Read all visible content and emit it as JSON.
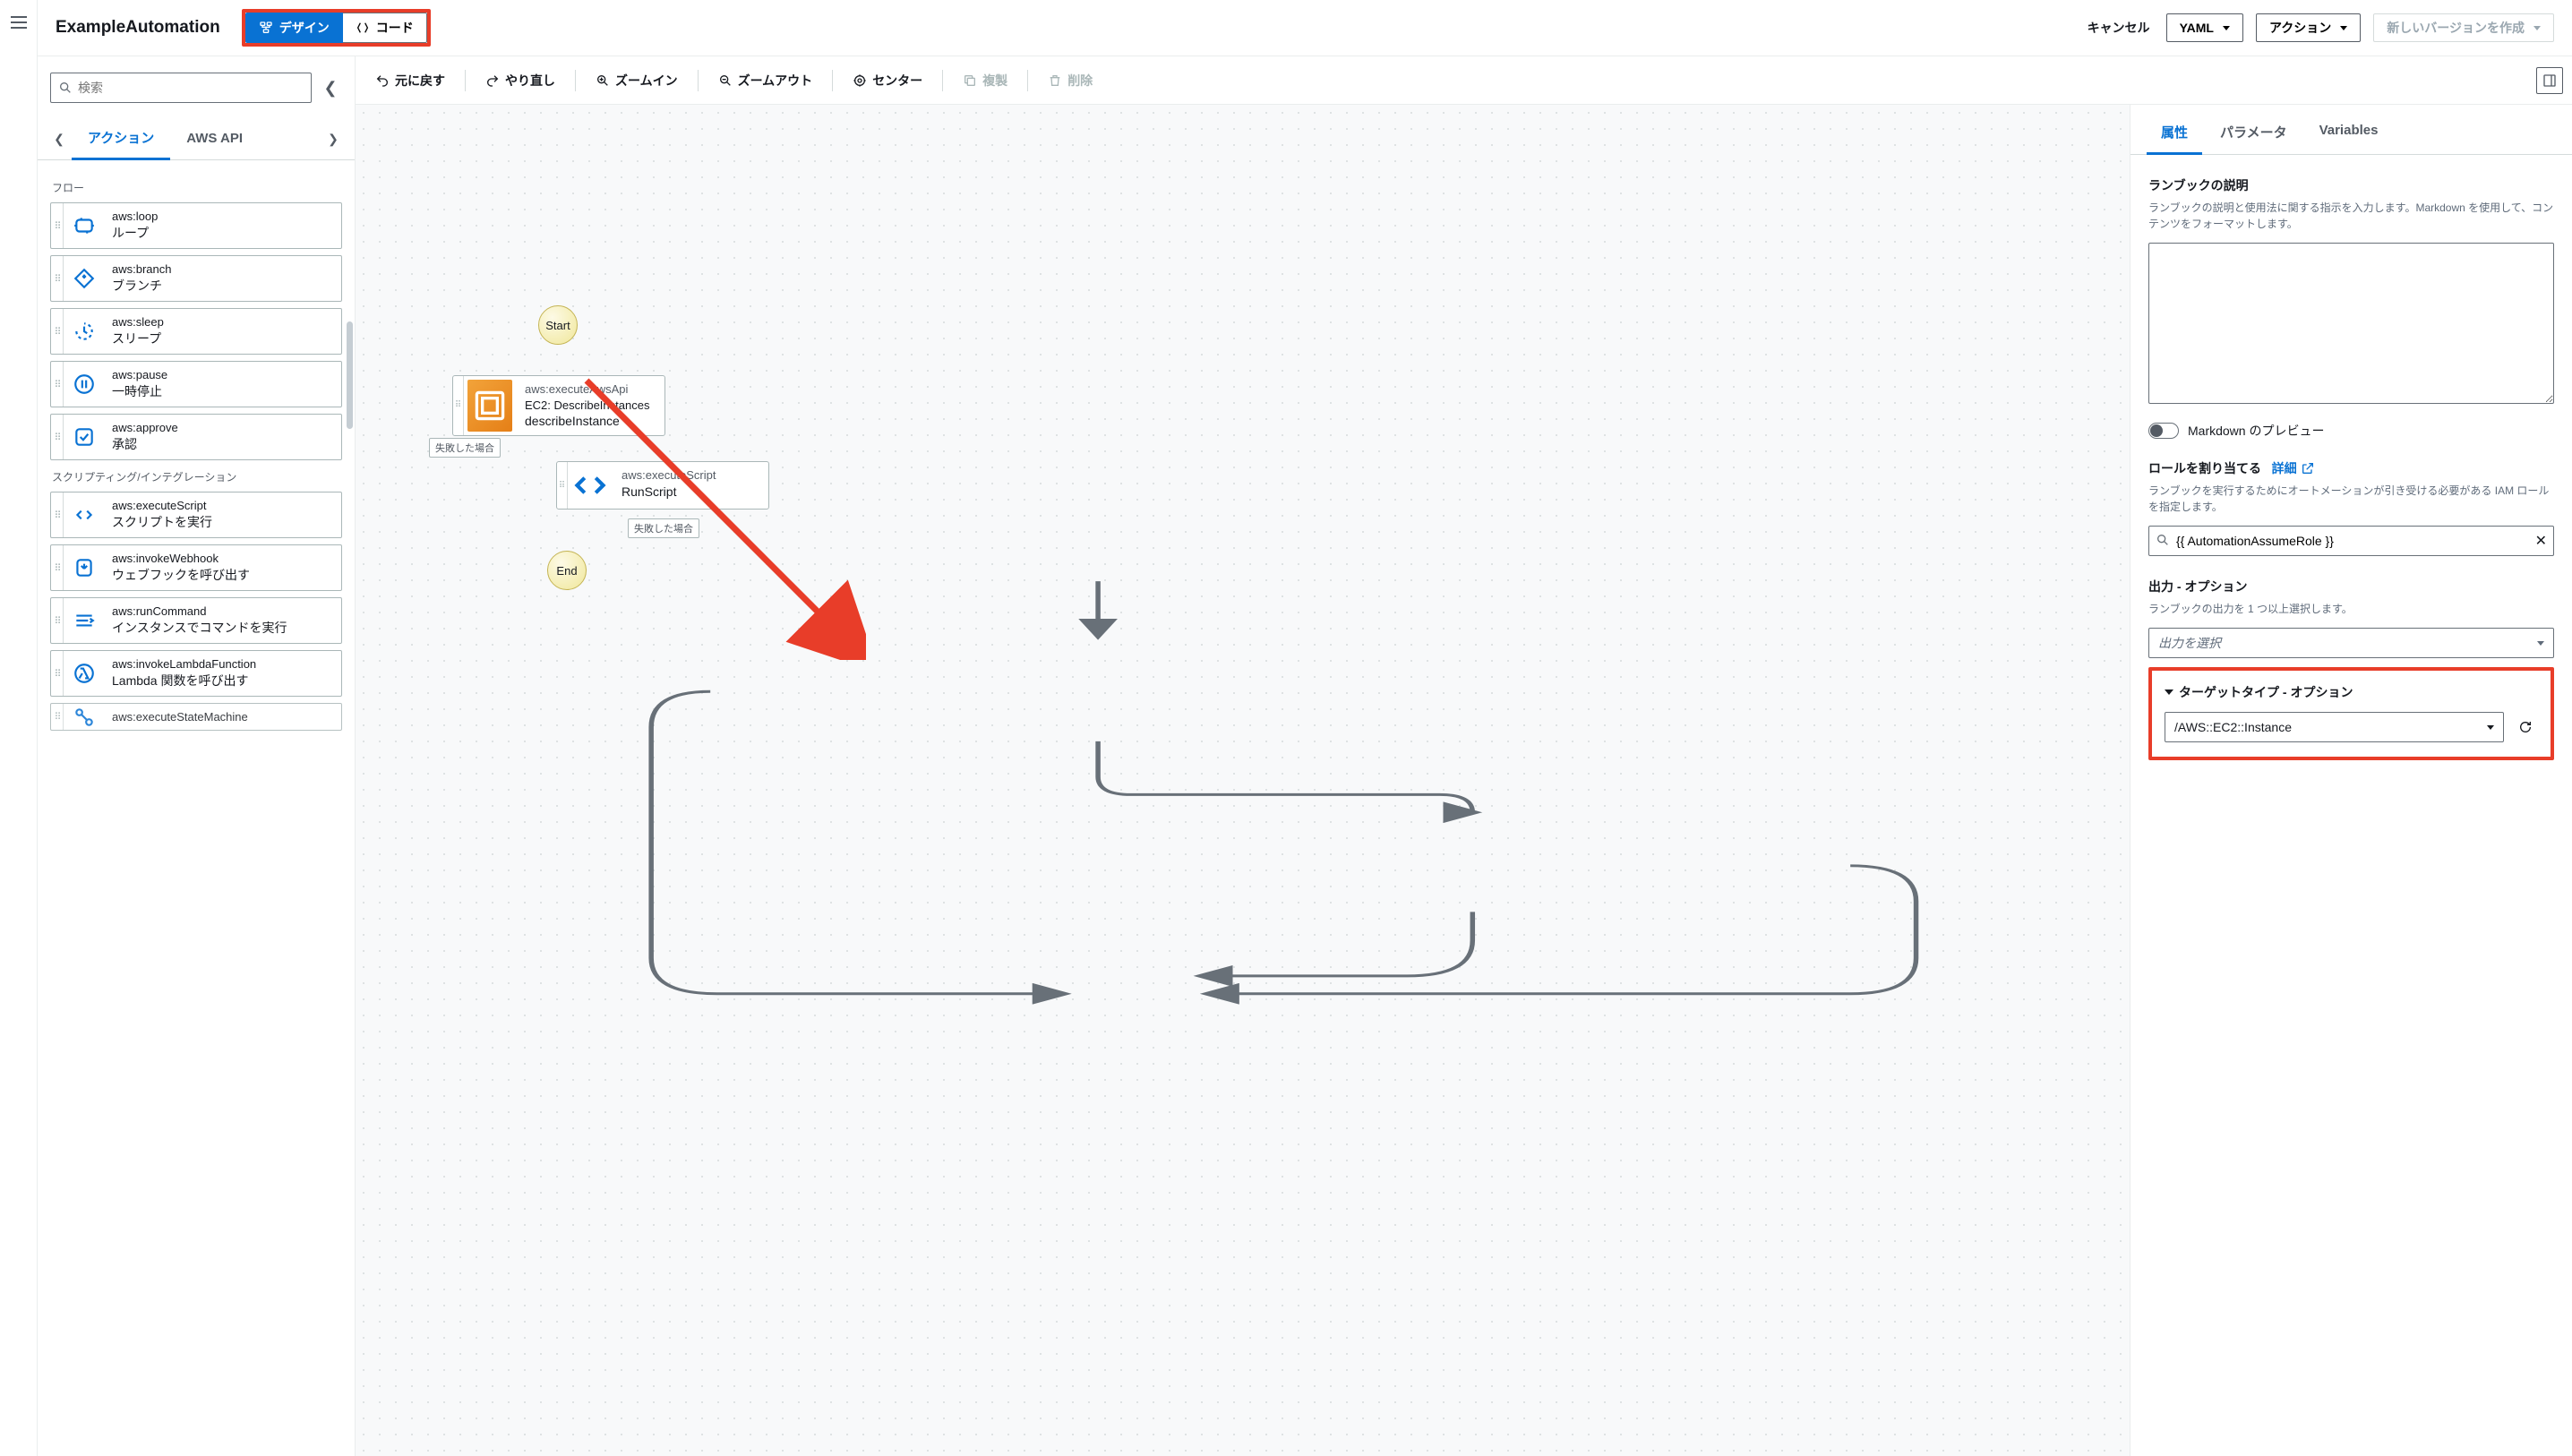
{
  "header": {
    "title": "ExampleAutomation",
    "design_label": "デザイン",
    "code_label": "コード",
    "cancel": "キャンセル",
    "format_select": "YAML",
    "actions_label": "アクション",
    "create_version": "新しいバージョンを作成"
  },
  "left_panel": {
    "search_placeholder": "検索",
    "tabs": {
      "actions": "アクション",
      "aws_api": "AWS API"
    },
    "sections": {
      "flow": "フロー",
      "scripting": "スクリプティング/インテグレーション"
    },
    "actions": {
      "loop": {
        "name": "aws:loop",
        "desc": "ループ"
      },
      "branch": {
        "name": "aws:branch",
        "desc": "ブランチ"
      },
      "sleep": {
        "name": "aws:sleep",
        "desc": "スリープ"
      },
      "pause": {
        "name": "aws:pause",
        "desc": "一時停止"
      },
      "approve": {
        "name": "aws:approve",
        "desc": "承認"
      },
      "executeScript": {
        "name": "aws:executeScript",
        "desc": "スクリプトを実行"
      },
      "invokeWebhook": {
        "name": "aws:invokeWebhook",
        "desc": "ウェブフックを呼び出す"
      },
      "runCommand": {
        "name": "aws:runCommand",
        "desc": "インスタンスでコマンドを実行"
      },
      "invokeLambda": {
        "name": "aws:invokeLambdaFunction",
        "desc": "Lambda 関数を呼び出す"
      },
      "executeStateMachine": {
        "name": "aws:executeStateMachine",
        "desc": ""
      }
    }
  },
  "toolbar": {
    "undo": "元に戻す",
    "redo": "やり直し",
    "zoom_in": "ズームイン",
    "zoom_out": "ズームアウト",
    "center": "センター",
    "duplicate": "複製",
    "delete": "削除"
  },
  "canvas": {
    "start": "Start",
    "end": "End",
    "fail_label": "失敗した場合",
    "step1": {
      "l1": "aws:executeAwsApi",
      "l2": "EC2: DescribeInstances",
      "l3": "describeInstance"
    },
    "step2": {
      "l1": "aws:executeScript",
      "l3": "RunScript"
    }
  },
  "right_panel": {
    "tabs": {
      "attrs": "属性",
      "params": "パラメータ",
      "vars": "Variables"
    },
    "desc_label": "ランブックの説明",
    "desc_help": "ランブックの説明と使用法に関する指示を入力します。Markdown を使用して、コンテンツをフォーマットします。",
    "md_preview": "Markdown のプレビュー",
    "role_label": "ロールを割り当てる",
    "role_link": "詳細",
    "role_help": "ランブックを実行するためにオートメーションが引き受ける必要がある IAM ロールを指定します。",
    "role_value": "{{ AutomationAssumeRole }}",
    "outputs_label": "出力 - オプション",
    "outputs_help": "ランブックの出力を 1 つ以上選択します。",
    "outputs_placeholder": "出力を選択",
    "target_label": "ターゲットタイプ - オプション",
    "target_value": "/AWS::EC2::Instance"
  }
}
